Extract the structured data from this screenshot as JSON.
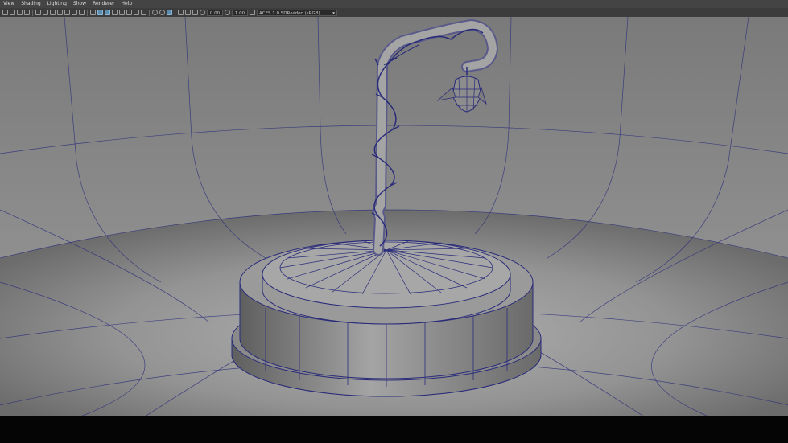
{
  "menu": {
    "items": [
      "View",
      "Shading",
      "Lighting",
      "Show",
      "Renderer",
      "Help"
    ]
  },
  "toolbar": {
    "exposure_value": "0.00",
    "gamma_value": "1.00",
    "color_space": "ACES 1.0 SDR-video (sRGB)",
    "dropdown_glyph": "▾"
  },
  "viewport": {
    "background_color": "#8e8e8e",
    "wire_color": "#2a2c7a"
  }
}
